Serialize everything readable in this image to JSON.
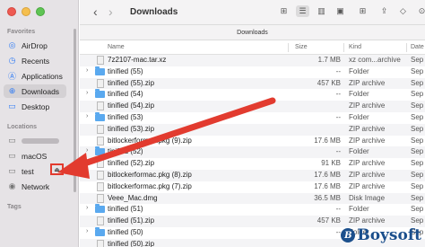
{
  "sidebar": {
    "favorites_label": "Favorites",
    "favorites": [
      {
        "label": "AirDrop",
        "icon": "airdrop-icon",
        "glyph": "◎"
      },
      {
        "label": "Recents",
        "icon": "clock-icon",
        "glyph": "◷"
      },
      {
        "label": "Applications",
        "icon": "applications-icon",
        "glyph": "Ⓐ"
      },
      {
        "label": "Downloads",
        "icon": "downloads-icon",
        "glyph": "⊕",
        "selected": true
      },
      {
        "label": "Desktop",
        "icon": "desktop-icon",
        "glyph": "▭"
      }
    ],
    "locations_label": "Locations",
    "locations": [
      {
        "label": "",
        "icon": "laptop-icon",
        "glyph": "▭",
        "blurred": true
      },
      {
        "label": "macOS",
        "icon": "disk-icon",
        "glyph": "▭"
      },
      {
        "label": "test",
        "icon": "disk-icon",
        "glyph": "▭"
      },
      {
        "label": "Network",
        "icon": "network-icon",
        "glyph": "◉"
      }
    ],
    "tags_label": "Tags",
    "eject_glyph": "⏏"
  },
  "toolbar": {
    "back": "‹",
    "forward": "›",
    "title": "Downloads",
    "view_icons": "⊞",
    "view_list": "☰",
    "view_columns": "▥",
    "view_gallery": "▣",
    "group": "⊞",
    "share": "⇪",
    "tag": "◇",
    "more": "⊙"
  },
  "pathbar": {
    "label": "Downloads"
  },
  "columns": {
    "name": "Name",
    "size": "Size",
    "kind": "Kind",
    "date": "Date"
  },
  "files": [
    {
      "name": "7z2107-mac.tar.xz",
      "size": "1.7 MB",
      "kind": "xz com...archive",
      "date": "Sep",
      "type": "doc",
      "disclosure": ""
    },
    {
      "name": "tinified (55)",
      "size": "--",
      "kind": "Folder",
      "date": "Sep",
      "type": "folder",
      "disclosure": "›"
    },
    {
      "name": "tinified (55).zip",
      "size": "457 KB",
      "kind": "ZIP archive",
      "date": "Sep",
      "type": "doc",
      "disclosure": ""
    },
    {
      "name": "tinified (54)",
      "size": "--",
      "kind": "Folder",
      "date": "Sep",
      "type": "folder",
      "disclosure": "›"
    },
    {
      "name": "tinified (54).zip",
      "size": "",
      "kind": "ZIP archive",
      "date": "Sep",
      "type": "doc",
      "disclosure": ""
    },
    {
      "name": "tinified (53)",
      "size": "--",
      "kind": "Folder",
      "date": "Sep",
      "type": "folder",
      "disclosure": "›"
    },
    {
      "name": "tinified (53).zip",
      "size": "",
      "kind": "ZIP archive",
      "date": "Sep",
      "type": "doc",
      "disclosure": ""
    },
    {
      "name": "bitlockerformac.pkg (9).zip",
      "size": "17.6 MB",
      "kind": "ZIP archive",
      "date": "Sep",
      "type": "doc",
      "disclosure": ""
    },
    {
      "name": "tinified (52)",
      "size": "--",
      "kind": "Folder",
      "date": "Sep",
      "type": "folder",
      "disclosure": "›"
    },
    {
      "name": "tinified (52).zip",
      "size": "91 KB",
      "kind": "ZIP archive",
      "date": "Sep",
      "type": "doc",
      "disclosure": ""
    },
    {
      "name": "bitlockerformac.pkg (8).zip",
      "size": "17.6 MB",
      "kind": "ZIP archive",
      "date": "Sep",
      "type": "doc",
      "disclosure": ""
    },
    {
      "name": "bitlockerformac.pkg (7).zip",
      "size": "17.6 MB",
      "kind": "ZIP archive",
      "date": "Sep",
      "type": "doc",
      "disclosure": ""
    },
    {
      "name": "Veee_Mac.dmg",
      "size": "36.5 MB",
      "kind": "Disk Image",
      "date": "Sep",
      "type": "doc",
      "disclosure": ""
    },
    {
      "name": "tinified (51)",
      "size": "--",
      "kind": "Folder",
      "date": "Sep",
      "type": "folder",
      "disclosure": "›"
    },
    {
      "name": "tinified (51).zip",
      "size": "457 KB",
      "kind": "ZIP archive",
      "date": "Sep",
      "type": "doc",
      "disclosure": ""
    },
    {
      "name": "tinified (50)",
      "size": "--",
      "kind": "Folder",
      "date": "Sep",
      "type": "folder",
      "disclosure": "›"
    },
    {
      "name": "tinified (50).zip",
      "size": "",
      "kind": "",
      "date": "",
      "type": "doc",
      "disclosure": ""
    }
  ],
  "watermark": {
    "mark": "B",
    "text": "Boysoft"
  },
  "colors": {
    "accent": "#2f7bf5",
    "annotation": "#e23b2f",
    "folder": "#5aa9ef"
  }
}
